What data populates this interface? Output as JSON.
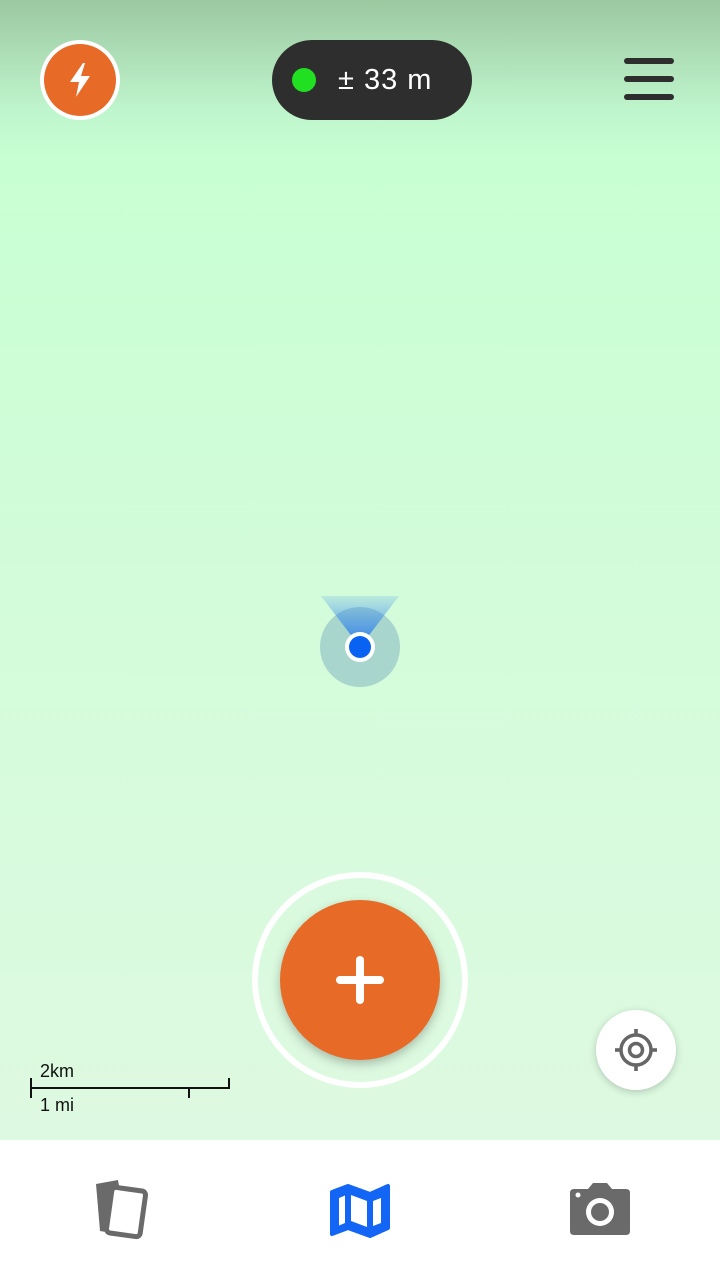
{
  "gps": {
    "accuracy_label": "± 33 m",
    "status_color": "#21e021"
  },
  "map": {
    "scale_metric": "2km",
    "scale_imperial": "1 mi"
  },
  "colors": {
    "accent": "#e86a27",
    "active_tab": "#1366f5",
    "inactive_tab": "#6a6a6a",
    "pill": "#2e2e2e"
  },
  "icons": {
    "power": "lightning-bolt-icon",
    "menu": "hamburger-menu-icon",
    "add": "plus-icon",
    "locate": "crosshair-locate-icon",
    "cards": "cards-icon",
    "map": "map-icon",
    "camera": "camera-icon"
  },
  "tabs": [
    {
      "id": "cards",
      "active": false
    },
    {
      "id": "map",
      "active": true
    },
    {
      "id": "camera",
      "active": false
    }
  ]
}
